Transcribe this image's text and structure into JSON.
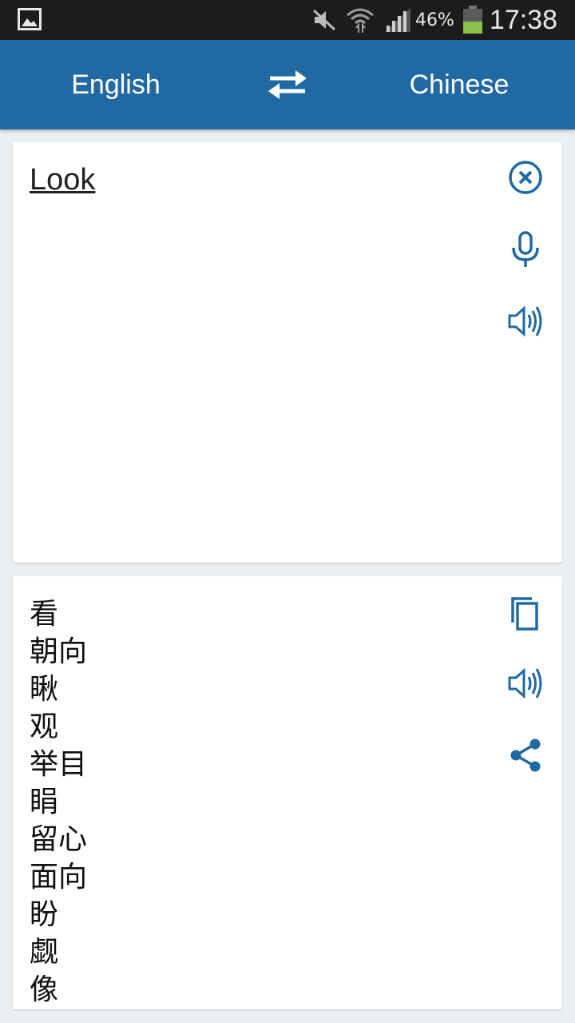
{
  "status_bar": {
    "battery_percent": "46%",
    "time": "17:38",
    "icons": [
      "gallery-icon",
      "mute-icon",
      "wifi-icon",
      "signal-icon",
      "battery-icon"
    ]
  },
  "app_bar": {
    "source_language": "English",
    "target_language": "Chinese",
    "swap_icon": "swap-arrows-icon"
  },
  "input_card": {
    "text": "Look",
    "icons": [
      "clear-icon",
      "microphone-icon",
      "speaker-icon"
    ]
  },
  "output_card": {
    "lines": [
      "看",
      "朝向",
      "瞅",
      "观",
      "举目",
      "睊",
      "留心",
      "面向",
      "盼",
      "觑",
      "像"
    ],
    "icons": [
      "copy-icon",
      "speaker-icon",
      "share-icon"
    ]
  },
  "colors": {
    "accent": "#2169a3",
    "status_bar": "#1c1c1c",
    "background": "#eceff1",
    "battery": "#8bc34a"
  }
}
